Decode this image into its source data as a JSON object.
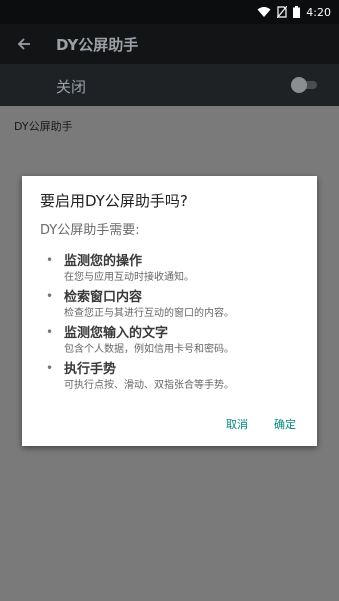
{
  "status_bar": {
    "time": "4:20"
  },
  "app_bar": {
    "title": "DY公屏助手",
    "back_icon": "arrow-back-icon"
  },
  "switch_bar": {
    "label": "关闭",
    "enabled": false
  },
  "content": {
    "label": "DY公屏助手"
  },
  "dialog": {
    "title": "要启用DY公屏助手吗?",
    "subtitle": "DY公屏助手需要:",
    "permissions": [
      {
        "title": "监测您的操作",
        "desc": "在您与应用互动时接收通知。"
      },
      {
        "title": "检索窗口内容",
        "desc": "检查您正与其进行互动的窗口的内容。"
      },
      {
        "title": "监测您输入的文字",
        "desc": "包含个人数据，例如信用卡号和密码。"
      },
      {
        "title": "执行手势",
        "desc": "可执行点按、滑动、双指张合等手势。"
      }
    ],
    "cancel_label": "取消",
    "ok_label": "确定"
  },
  "colors": {
    "accent": "#00897b",
    "dialog_bg": "#ffffff",
    "scrim": "#7a7a7a"
  }
}
